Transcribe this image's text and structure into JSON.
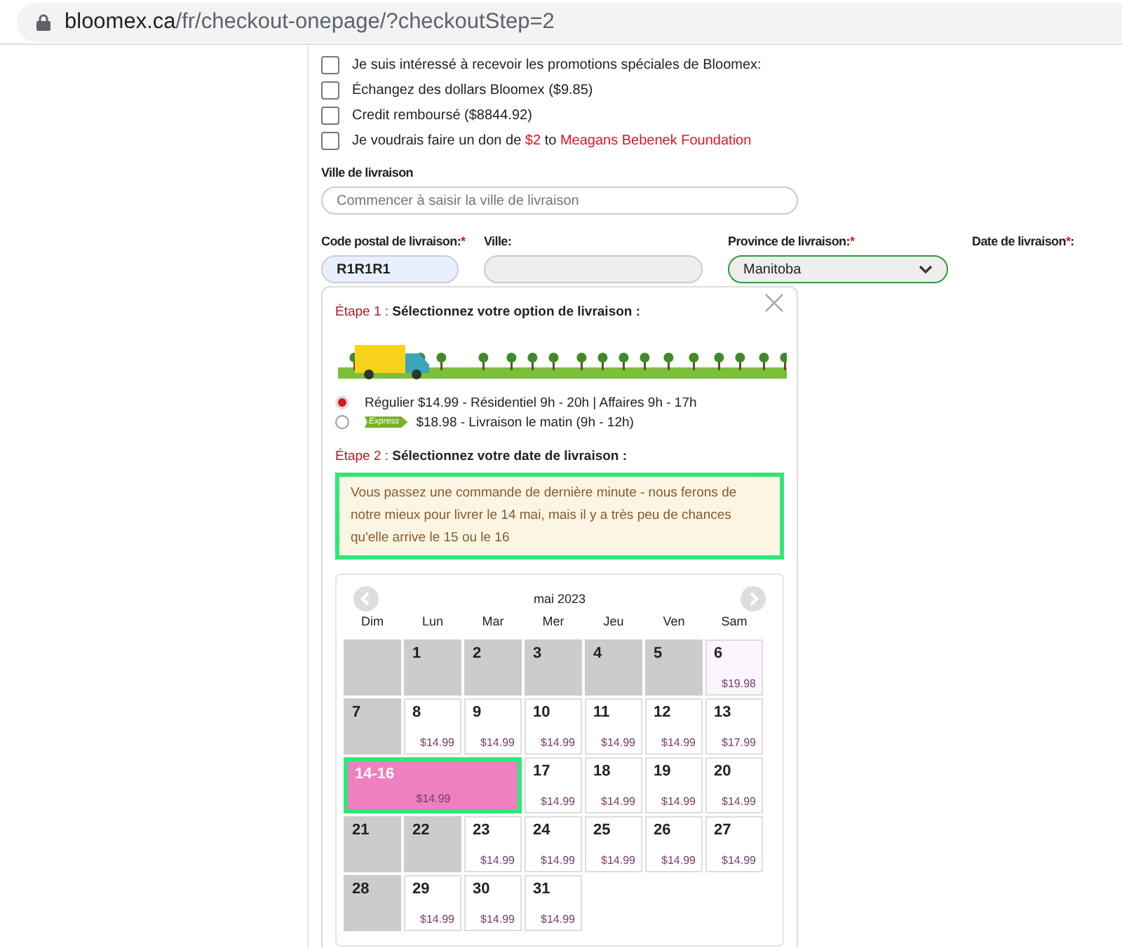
{
  "address_bar": {
    "domain": "bloomex.ca",
    "path": "/fr/checkout-onepage/?checkoutStep=2"
  },
  "options": [
    {
      "checked": false,
      "parts": [
        {
          "text": "Je suis intéressé à recevoir les promotions spéciales de Bloomex:",
          "kind": "plain"
        }
      ]
    },
    {
      "checked": false,
      "parts": [
        {
          "text": "Échangez des dollars Bloomex ($9.85)",
          "kind": "plain"
        }
      ]
    },
    {
      "checked": false,
      "parts": [
        {
          "text": "Credit remboursé ($8844.92)",
          "kind": "plain"
        }
      ]
    },
    {
      "checked": false,
      "parts": [
        {
          "text": "Je voudrais faire un don de ",
          "kind": "plain"
        },
        {
          "text": "$2",
          "kind": "accent"
        },
        {
          "text": " to ",
          "kind": "plain"
        },
        {
          "text": "Meagans Bebenek Foundation",
          "kind": "accent"
        }
      ]
    }
  ],
  "city_search": {
    "label": "Ville de livraison",
    "placeholder": "Commencer à saisir la ville de livraison"
  },
  "fields": [
    {
      "kind": "text",
      "label": [
        {
          "text": "Code postal de livraison:",
          "kind": "plain"
        },
        {
          "text": "*",
          "kind": "required"
        }
      ],
      "value": "R1R1R1"
    },
    {
      "kind": "readonly",
      "label": [
        {
          "text": "Ville:",
          "kind": "plain"
        }
      ]
    },
    {
      "kind": "select",
      "label": [
        {
          "text": "Province de livraison:",
          "kind": "plain"
        },
        {
          "text": "*",
          "kind": "required"
        }
      ],
      "value": "Manitoba"
    },
    {
      "kind": "none",
      "label": [
        {
          "text": "Date de livraison",
          "kind": "plain"
        },
        {
          "text": "*",
          "kind": "required"
        },
        {
          "text": ":",
          "kind": "plain"
        }
      ]
    }
  ],
  "popup": {
    "step1": {
      "step": "Étape 1 :",
      "title": "Sélectionnez votre option de livraison :"
    },
    "shipping": [
      {
        "selected": true,
        "text": "Régulier $14.99 - Résidentiel 9h - 20h | Affaires 9h - 17h"
      },
      {
        "selected": false,
        "badge": "Express",
        "text": "$18.98 - Livraison le matin (9h - 12h)"
      }
    ],
    "step2": {
      "step": "Étape 2 :",
      "title": "Sélectionnez votre date de livraison :"
    },
    "notice": "Vous passez une commande de dernière minute - nous ferons de notre mieux pour livrer le 14 mai, mais il y a très peu de chances qu'elle arrive le 15 ou le 16",
    "calendar": {
      "month": "mai 2023",
      "weekdays": [
        "Dim",
        "Lun",
        "Mar",
        "Mer",
        "Jeu",
        "Ven",
        "Sam"
      ],
      "weeks": [
        [
          {
            "kind": "disabled"
          },
          {
            "kind": "disabled",
            "day": "1"
          },
          {
            "kind": "disabled",
            "day": "2"
          },
          {
            "kind": "disabled",
            "day": "3"
          },
          {
            "kind": "disabled",
            "day": "4"
          },
          {
            "kind": "disabled",
            "day": "5"
          },
          {
            "kind": "special",
            "day": "6",
            "price": "$19.98"
          }
        ],
        [
          {
            "kind": "disabled",
            "day": "7"
          },
          {
            "kind": "available",
            "day": "8",
            "price": "$14.99"
          },
          {
            "kind": "available",
            "day": "9",
            "price": "$14.99"
          },
          {
            "kind": "available",
            "day": "10",
            "price": "$14.99"
          },
          {
            "kind": "available",
            "day": "11",
            "price": "$14.99"
          },
          {
            "kind": "available",
            "day": "12",
            "price": "$14.99"
          },
          {
            "kind": "available",
            "day": "13",
            "price": "$17.99"
          }
        ],
        [
          {
            "kind": "range",
            "day": "14-16",
            "price": "$14.99"
          },
          {
            "kind": "available",
            "day": "17",
            "price": "$14.99"
          },
          {
            "kind": "available",
            "day": "18",
            "price": "$14.99"
          },
          {
            "kind": "available",
            "day": "19",
            "price": "$14.99"
          },
          {
            "kind": "available",
            "day": "20",
            "price": "$14.99"
          }
        ],
        [
          {
            "kind": "disabled",
            "day": "21"
          },
          {
            "kind": "disabled",
            "day": "22"
          },
          {
            "kind": "available",
            "day": "23",
            "price": "$14.99"
          },
          {
            "kind": "available",
            "day": "24",
            "price": "$14.99"
          },
          {
            "kind": "available",
            "day": "25",
            "price": "$14.99"
          },
          {
            "kind": "available",
            "day": "26",
            "price": "$14.99"
          },
          {
            "kind": "available",
            "day": "27",
            "price": "$14.99"
          }
        ],
        [
          {
            "kind": "disabled",
            "day": "28"
          },
          {
            "kind": "available",
            "day": "29",
            "price": "$14.99"
          },
          {
            "kind": "available",
            "day": "30",
            "price": "$14.99"
          },
          {
            "kind": "available",
            "day": "31",
            "price": "$14.99"
          }
        ]
      ]
    }
  }
}
